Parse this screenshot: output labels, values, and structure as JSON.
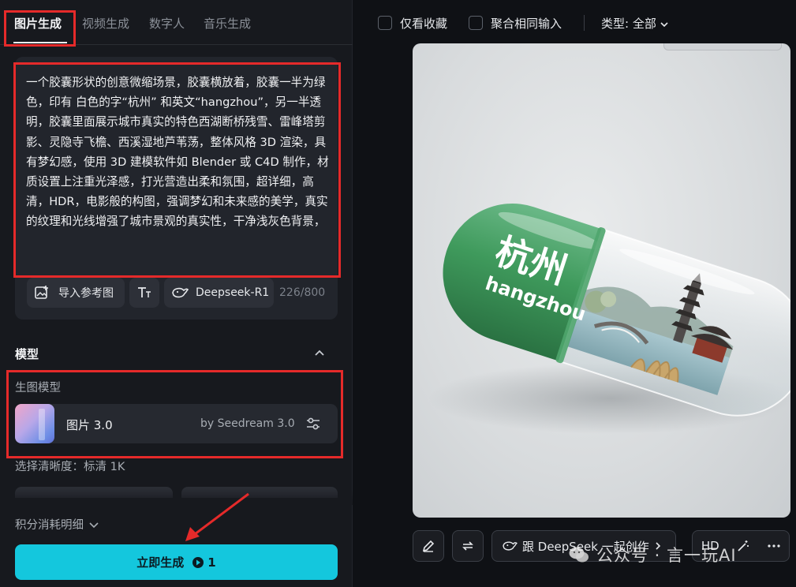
{
  "tabs": [
    {
      "label": "图片生成",
      "active": true
    },
    {
      "label": "视频生成"
    },
    {
      "label": "数字人"
    },
    {
      "label": "音乐生成"
    }
  ],
  "prompt": {
    "text": "一个胶囊形状的创意微缩场景，胶囊横放着，胶囊一半为绿色，印有 白色的字“杭州” 和英文“hangzhou”，另一半透明，胶囊里面展示城市真实的特色西湖断桥残雪、雷峰塔剪影、灵隐寺飞檐、西溪湿地芦苇荡，整体风格 3D 渲染，具有梦幻感，使用 3D 建模软件如 Blender 或 C4D 制作，材质设置上注重光泽感，打光营造出柔和氛围，超详细，高清，HDR，电影般的构图，强调梦幻和未来感的美学，真实的纹理和光线增强了城市景观的真实性，干净浅灰色背景，",
    "import_label": "导入参考图",
    "deepseek_label": "Deepseek-R1",
    "counter": "226/800"
  },
  "model_section": {
    "title": "模型",
    "sub_label": "生图模型",
    "model_name": "图片 3.0",
    "model_by": "by Seedream 3.0",
    "resolution_label": "选择清晰度：标清 1K"
  },
  "cost_label": "积分消耗明细",
  "generate": {
    "label": "立即生成",
    "cost": "1"
  },
  "top_bar": {
    "favorites_only": "仅看收藏",
    "merge_same_input": "聚合相同输入",
    "type_select": "类型: 全部"
  },
  "image": {
    "capsule_cn": "杭州",
    "capsule_en": "hangzhou"
  },
  "image_tools": {
    "deepseek_create": "跟 DeepSeek 一起创作",
    "hd": "HD"
  },
  "watermark": "公众号 · 言一玩AI",
  "colors": {
    "accent": "#14c7dd",
    "highlight_red": "#e52a2a",
    "capsule_green": "#3f9a5c"
  }
}
